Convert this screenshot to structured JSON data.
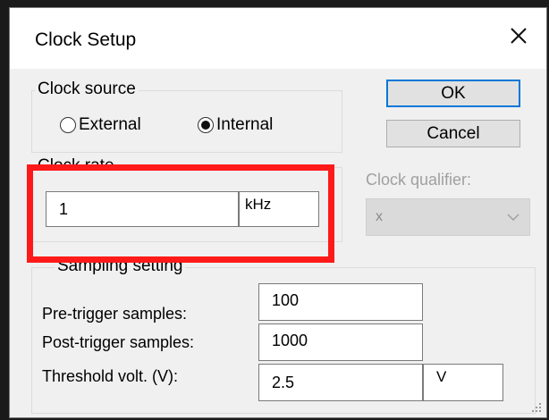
{
  "dialog": {
    "title": "Clock Setup"
  },
  "clock_source": {
    "label": "Clock source",
    "options": [
      {
        "label": "External",
        "selected": false
      },
      {
        "label": "Internal",
        "selected": true
      }
    ]
  },
  "buttons": {
    "ok": "OK",
    "cancel": "Cancel"
  },
  "clock_rate": {
    "label": "Clock rate",
    "value": "1",
    "unit": "kHz"
  },
  "clock_qualifier": {
    "label": "Clock qualifier:",
    "value": "x",
    "enabled": false
  },
  "sampling": {
    "label": "Sampling setting",
    "pre_trigger": {
      "label": "Pre-trigger samples:",
      "value": "100"
    },
    "post_trigger": {
      "label": "Post-trigger samples:",
      "value": "1000"
    },
    "threshold": {
      "label": "Threshold volt. (V):",
      "value": "2.5",
      "unit": "V"
    }
  },
  "colors": {
    "highlight": "#ff1a1a",
    "default_button_border": "#0078d7"
  }
}
